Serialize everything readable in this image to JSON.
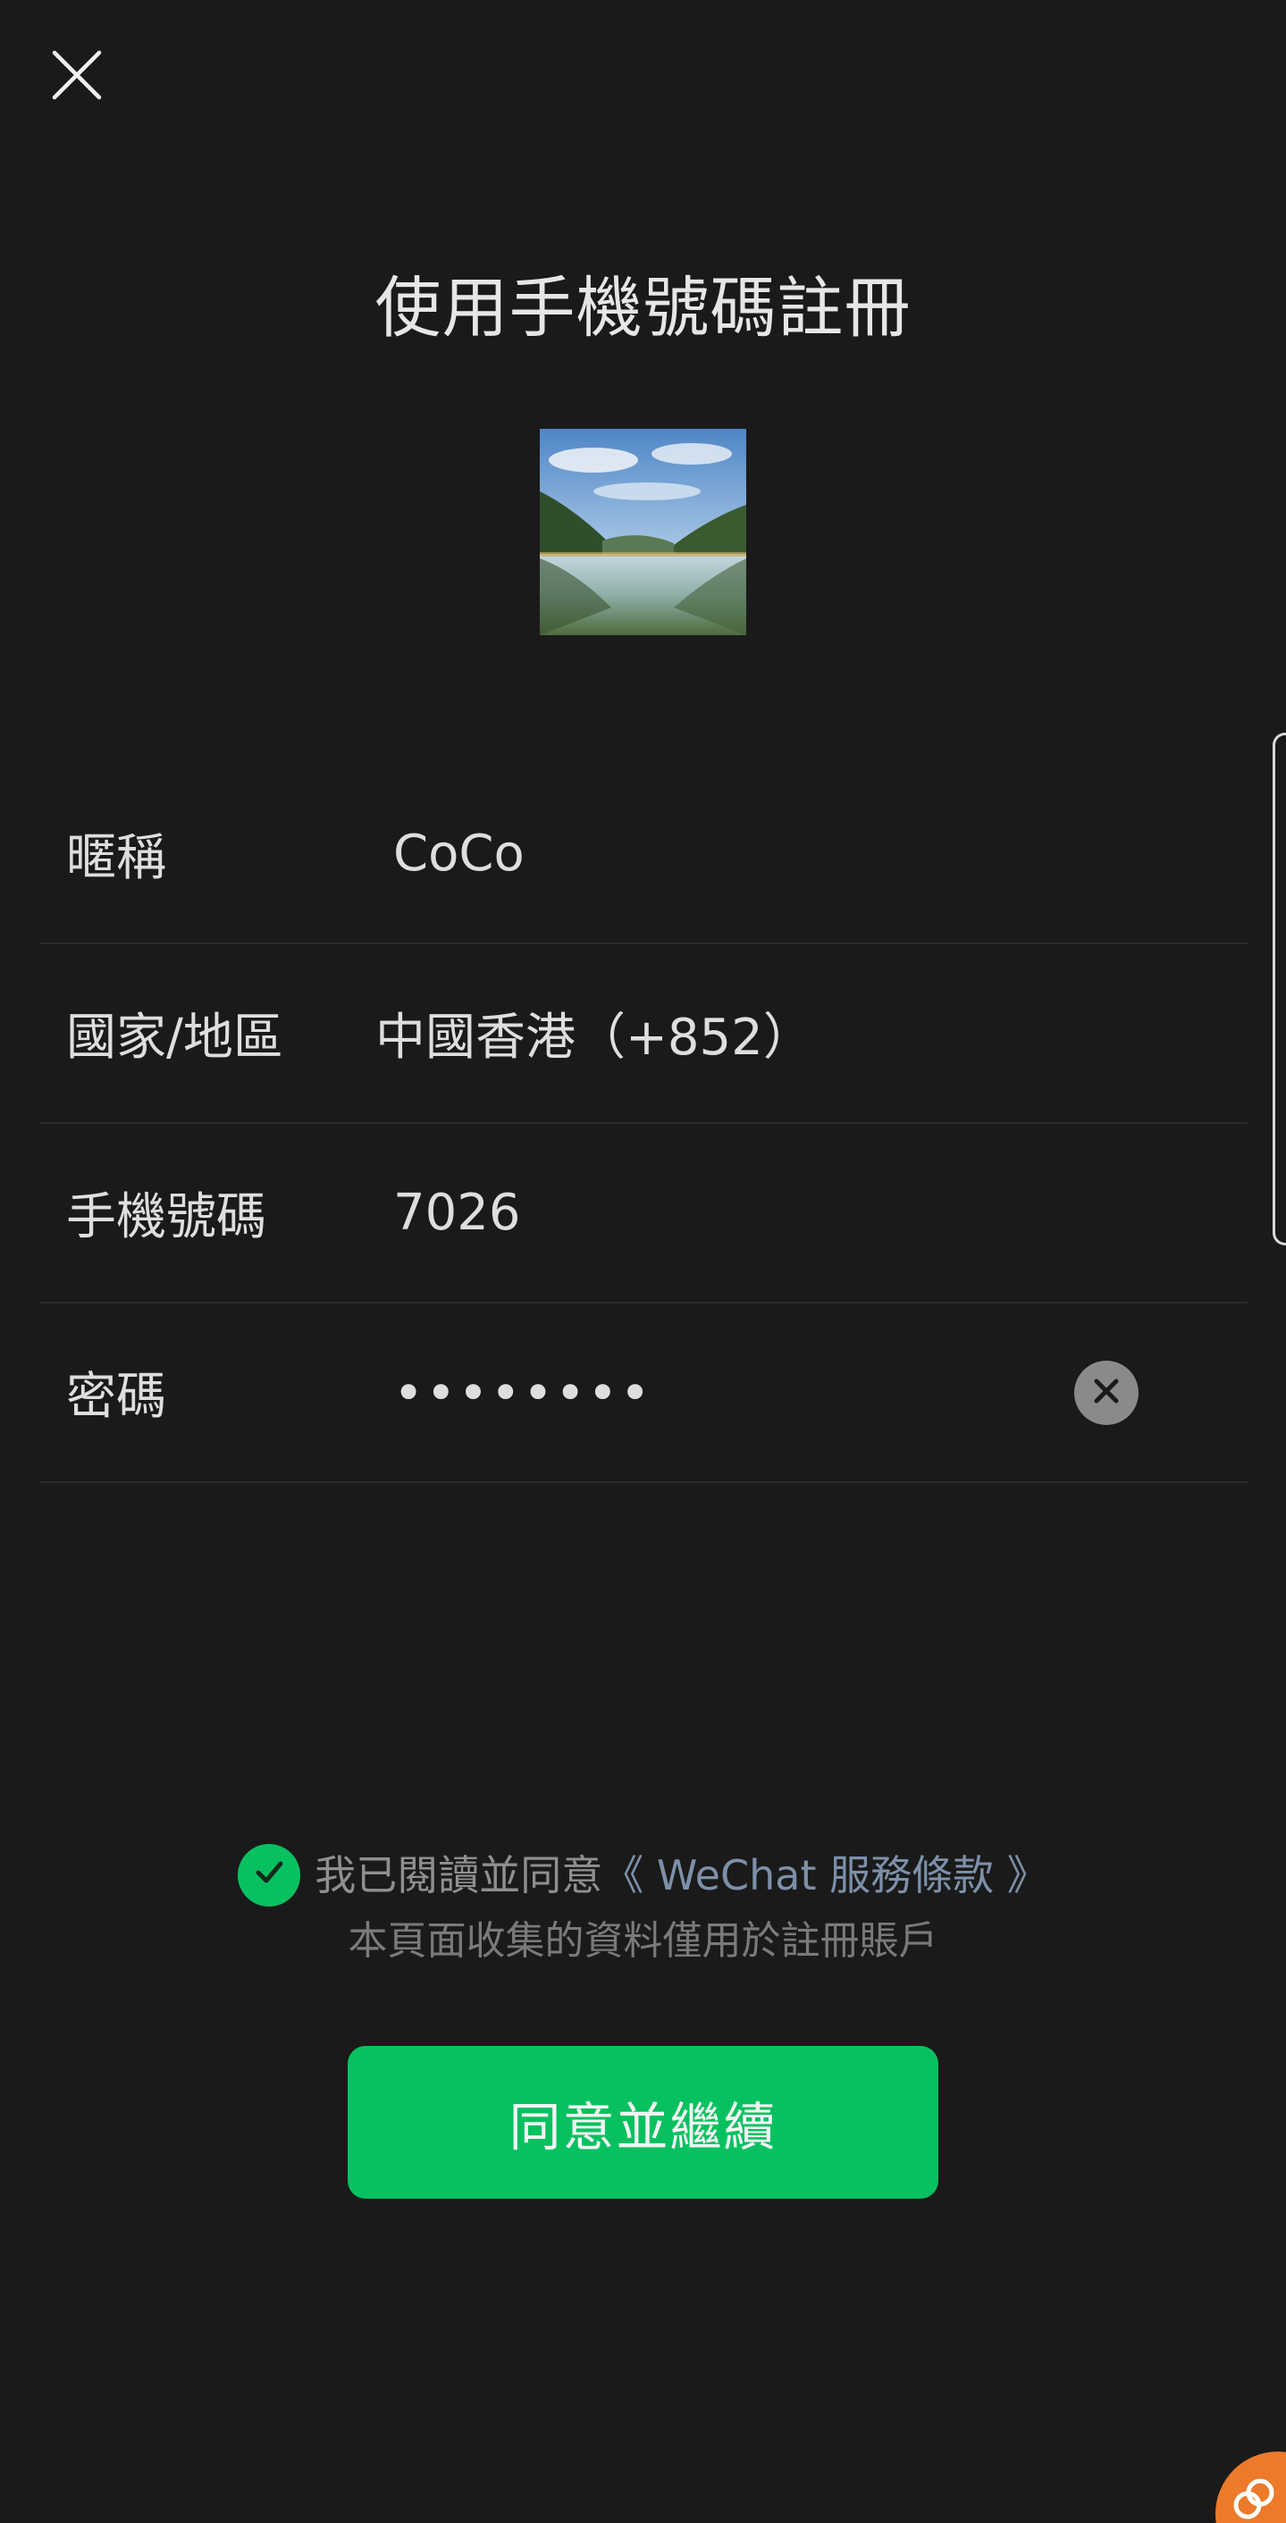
{
  "title": "使用手機號碼註冊",
  "avatar": {
    "icon": "landscape-lake-photo"
  },
  "form": {
    "nickname": {
      "label": "暱稱",
      "value": "CoCo"
    },
    "region": {
      "label": "國家/地區",
      "value": "中國香港（+852）"
    },
    "phone": {
      "label": "手機號碼",
      "value": "7026"
    },
    "password": {
      "label": "密碼",
      "value": "••••••••"
    }
  },
  "agreement": {
    "prefix": "我已閱讀並同意",
    "link": "《 WeChat 服務條款 》",
    "checked": true
  },
  "notice": "本頁面收集的資料僅用於註冊賬戶",
  "primary_button": "同意並繼續",
  "colors": {
    "background": "#1a1a1a",
    "accent": "#07c160",
    "link": "#7d90a9",
    "widget": "#ec7a2a"
  }
}
